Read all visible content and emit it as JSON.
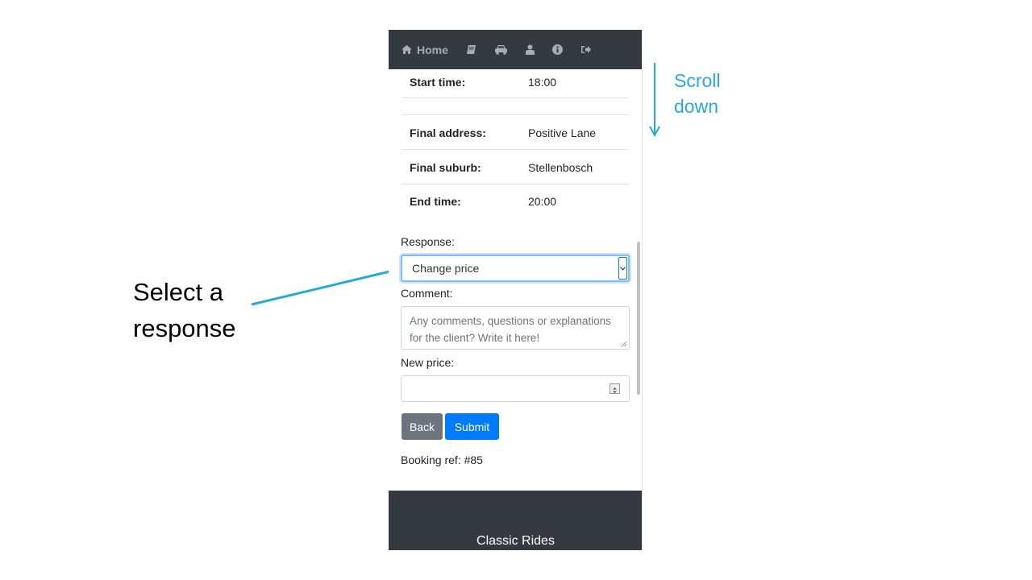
{
  "annotations": {
    "select_response": [
      "Select a",
      "response"
    ],
    "scroll_down": [
      "Scroll",
      "down"
    ]
  },
  "navbar": {
    "home_label": "Home",
    "icons": [
      "home-icon",
      "book-icon",
      "car-icon",
      "user-icon",
      "info-icon",
      "sign-out-icon"
    ]
  },
  "details": [
    {
      "label": "Start time:",
      "value": "18:00"
    },
    {
      "label": "Final address:",
      "value": "Positive Lane"
    },
    {
      "label": "Final suburb:",
      "value": "Stellenbosch"
    },
    {
      "label": "End time:",
      "value": "20:00"
    }
  ],
  "form": {
    "response_label": "Response:",
    "response_selected": "Change price",
    "comment_label": "Comment:",
    "comment_placeholder": "Any comments, questions or explanations for the client? Write it here!",
    "new_price_label": "New price:",
    "new_price_value": "",
    "back_label": "Back",
    "submit_label": "Submit"
  },
  "booking_ref": "Booking ref: #85",
  "footer": {
    "title": "Classic Rides"
  },
  "colors": {
    "navbar_bg": "#343a40",
    "primary": "#007bff",
    "secondary": "#6c757d",
    "annotation_blue": "#29a8d9"
  }
}
